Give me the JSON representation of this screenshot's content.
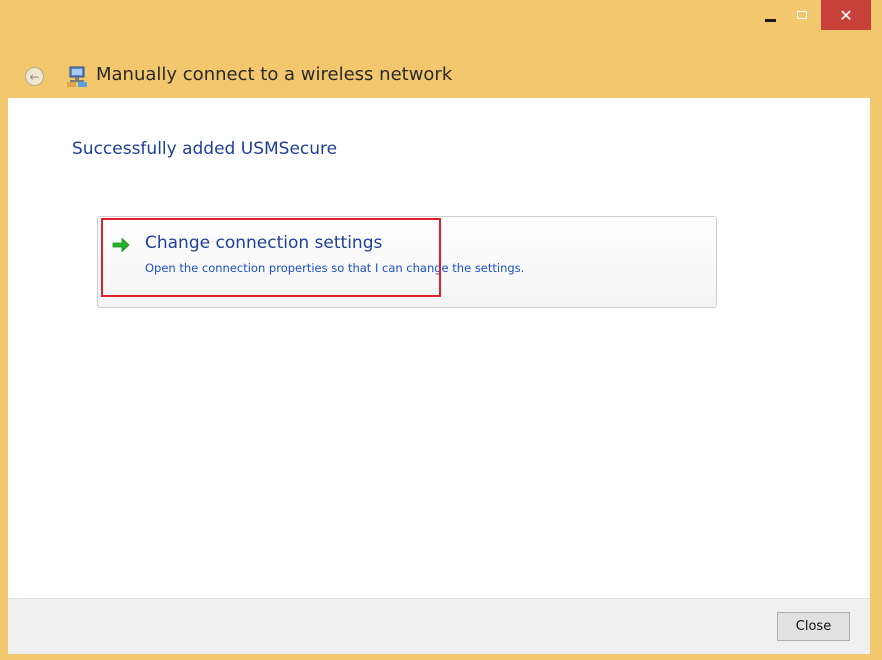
{
  "titlebar": {
    "minimize_icon": "minimize-icon",
    "maximize_icon": "maximize-icon",
    "close_glyph": "✕"
  },
  "header": {
    "back_icon": "back-arrow-icon",
    "network_icon": "network-icon",
    "title": "Manually connect to a wireless network"
  },
  "content": {
    "heading": "Successfully added USMSecure",
    "command_link": {
      "icon": "green-arrow-icon",
      "title": "Change connection settings",
      "description": "Open the connection properties so that I can change the settings."
    }
  },
  "footer": {
    "close_label": "Close"
  },
  "colors": {
    "frame": "#f2c76e",
    "close_button": "#c7413a",
    "heading_blue": "#1e3f9a",
    "link_blue": "#1a4fc8",
    "highlight_red": "#e0202a"
  }
}
